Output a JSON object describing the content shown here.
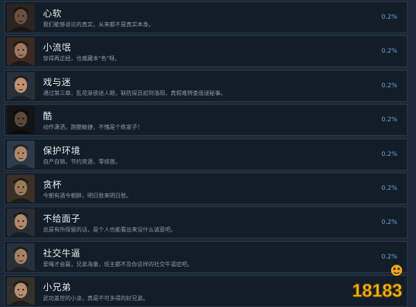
{
  "achievements": [
    {
      "title": "心软",
      "desc": "我们能够谈论的真实，从来都不是真实本身。",
      "percent": "0.2%",
      "icon": "portrait-man-dark-hair-icon"
    },
    {
      "title": "小流氓",
      "desc": "穿得再正经，也难藏本\"色\"呀。",
      "percent": "0.2%",
      "icon": "portrait-man-official-hat-icon"
    },
    {
      "title": "戏与迷",
      "desc": "通过第三章，乱花渐欲迷人眼，联防探员初到洛阳，真假难辨查造谜秘事。",
      "percent": "0.2%",
      "icon": "portrait-opera-performer-icon"
    },
    {
      "title": "酷",
      "desc": "动作潇洒，跑酷敏捷，不愧是个练家子！",
      "percent": "0.2%",
      "icon": "portrait-dark-scene-icon"
    },
    {
      "title": "保护环境",
      "desc": "自产自销，节约资源，零排放。",
      "percent": "0.2%",
      "icon": "portrait-man-headband-icon"
    },
    {
      "title": "贪杯",
      "desc": "今朝有酒今朝醉，明日愁来明日愁。",
      "percent": "0.2%",
      "icon": "portrait-man-in-room-icon"
    },
    {
      "title": "不给面子",
      "desc": "总是有所保留的话，是个人也能看出来没什么诚意吧。",
      "percent": "0.2%",
      "icon": "portrait-man-hat-side-icon"
    },
    {
      "title": "社交牛逼",
      "desc": "爱嘴才会赢，兄弟海量，班主都不及你这样的社交牛逼症吧。",
      "percent": "0.2%",
      "icon": "portrait-man-outdoor-icon"
    },
    {
      "title": "小兄弟",
      "desc": "武功盖世的小凌，真是不可多得的好兄弟。",
      "percent": "",
      "icon": "portrait-man-laughing-icon"
    }
  ],
  "watermark": {
    "text": "18183",
    "icon": "watermark-logo-icon"
  },
  "colors": {
    "background": "#1b2838",
    "row": "#131d28",
    "border": "#2a3a4b",
    "title": "#e6eef5",
    "desc": "#8a9aab",
    "percent": "#66a6d9"
  }
}
